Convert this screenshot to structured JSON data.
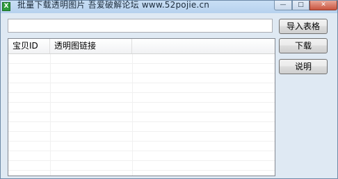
{
  "window": {
    "title": "批量下载透明图片  吾爱破解论坛  www.52pojie.cn",
    "icon": "excel-app-icon",
    "controls": {
      "minimize": "—",
      "maximize": "□",
      "close": "✕"
    }
  },
  "search": {
    "value": "",
    "placeholder": ""
  },
  "buttons": {
    "import_label": "导入表格",
    "download_label": "下载",
    "help_label": "说明"
  },
  "table": {
    "columns": [
      "宝贝ID",
      "透明图链接",
      ""
    ],
    "rows": []
  }
}
